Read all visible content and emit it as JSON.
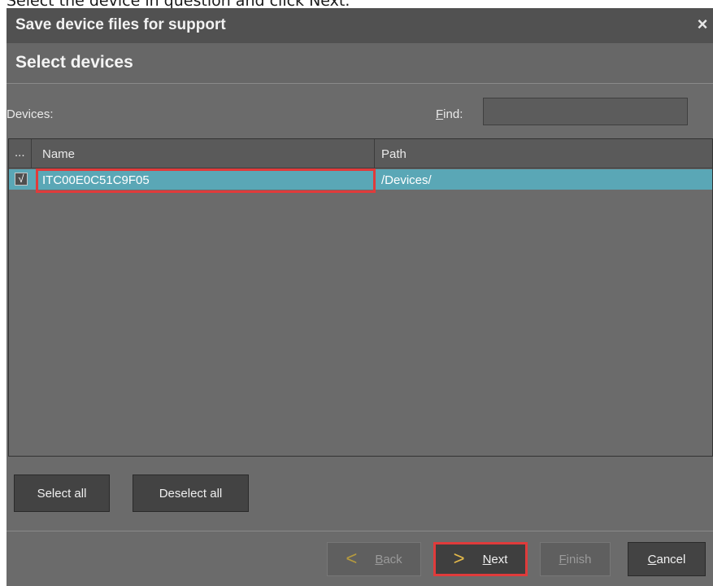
{
  "caption": "Select the device in question and click Next.",
  "dialog": {
    "title": "Save device files for support",
    "close_label": "×",
    "heading": "Select devices"
  },
  "devices_label": "Devices:",
  "find": {
    "label_accesskey": "F",
    "label_rest": "ind:",
    "value": ""
  },
  "table": {
    "columns": [
      "...",
      "Name",
      "Path"
    ],
    "rows": [
      {
        "checked": true,
        "check_glyph": "√",
        "name": "ITC00E0C51C9F05",
        "path": "/Devices/"
      }
    ],
    "selected_row_color": "#5aa7b6"
  },
  "buttons": {
    "select_all": "Select all",
    "deselect_all": "Deselect all",
    "back": {
      "accesskey": "B",
      "rest": "ack",
      "icon": "chevron-left-icon",
      "glyph": "<"
    },
    "next": {
      "accesskey": "N",
      "rest": "ext",
      "icon": "chevron-right-icon",
      "glyph": ">"
    },
    "finish": {
      "accesskey": "F",
      "rest": "inish"
    },
    "cancel": {
      "accesskey": "C",
      "rest": "ancel"
    }
  },
  "colors": {
    "highlight": "#e03b3b",
    "dialog_bg": "#6b6b6b",
    "titlebar_bg": "#515151"
  }
}
